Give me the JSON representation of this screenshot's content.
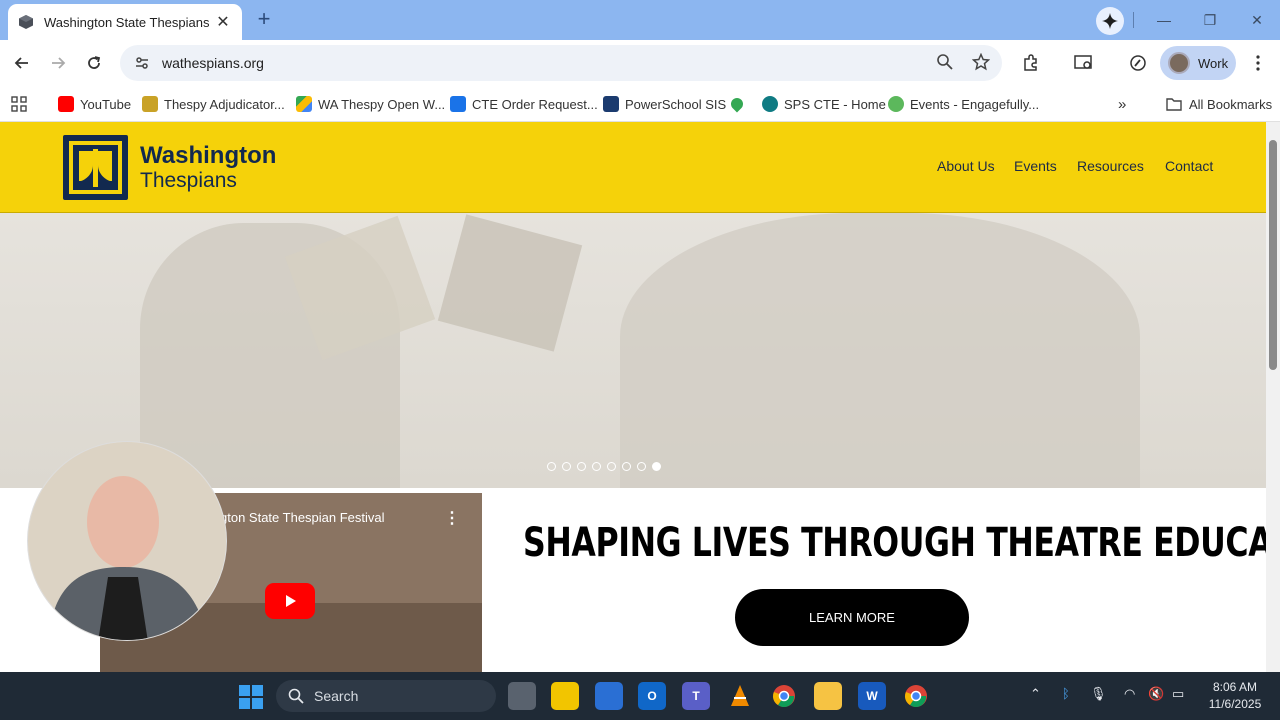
{
  "browser": {
    "tab_title": "Washington State Thespians",
    "url": "wathespians.org",
    "profile_label": "Work",
    "bookmarks": [
      {
        "label": "YouTube",
        "icon": "youtube-icon"
      },
      {
        "label": "Thespy Adjudicator...",
        "icon": "thespy-icon"
      },
      {
        "label": "WA Thespy Open W...",
        "icon": "drive-icon"
      },
      {
        "label": "CTE Order Request...",
        "icon": "xm-icon"
      },
      {
        "label": "PowerSchool SIS",
        "icon": "sis-icon"
      },
      {
        "label": "",
        "icon": "maps-pin-icon"
      },
      {
        "label": "SPS CTE - Home",
        "icon": "sharepoint-icon"
      },
      {
        "label": "Events - Engagefully...",
        "icon": "engagefully-icon"
      }
    ],
    "all_bookmarks_label": "All Bookmarks"
  },
  "site": {
    "logo": {
      "line1": "Washington",
      "line2": "Thespians"
    },
    "nav": [
      "About Us",
      "Events",
      "Resources",
      "Contact"
    ],
    "headline": "SHAPING LIVES THROUGH THEATRE EDUCATION.",
    "cta_label": "LEARN MORE",
    "video_title": "gton State Thespian Festival",
    "slider_dots": 8,
    "active_dot": 7
  },
  "taskbar": {
    "search_label": "Search",
    "time": "8:06 AM",
    "date": "11/6/2025"
  },
  "colors": {
    "header_yellow": "#f5d20a",
    "logo_navy": "#12294f",
    "tabstrip_blue": "#8cb6f0",
    "taskbar_dark": "#1f2a36"
  }
}
